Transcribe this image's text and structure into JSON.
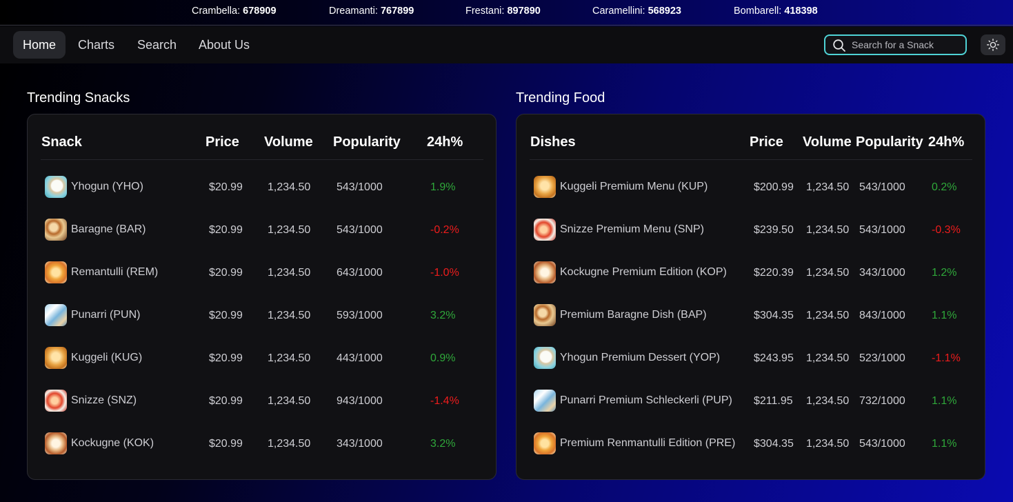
{
  "ticker": [
    {
      "name": "Crambella:",
      "value": "678909"
    },
    {
      "name": "Dreamanti:",
      "value": "767899"
    },
    {
      "name": "Frestani:",
      "value": "897890"
    },
    {
      "name": "Caramellini:",
      "value": "568923"
    },
    {
      "name": "Bombarell:",
      "value": "418398"
    }
  ],
  "nav": {
    "items": [
      "Home",
      "Charts",
      "Search",
      "About Us"
    ],
    "active": "Home"
  },
  "search": {
    "placeholder": "Search for a Snack",
    "value": ""
  },
  "colors": {
    "positive": "#2fa83a",
    "negative": "#ee1c1c",
    "search_border": "#4fd3d6"
  },
  "snacks": {
    "title": "Trending Snacks",
    "headers": [
      "Snack",
      "Price",
      "Volume",
      "Popularity",
      "24h%"
    ],
    "rows": [
      {
        "name": "Yhogun (YHO)",
        "price": "$20.99",
        "volume": "1,234.50",
        "popularity": "543/1000",
        "change": "1.9%",
        "trend": "up",
        "icon": "yhogun-thumb-icon"
      },
      {
        "name": "Baragne (BAR)",
        "price": "$20.99",
        "volume": "1,234.50",
        "popularity": "543/1000",
        "change": "-0.2%",
        "trend": "down",
        "icon": "baragne-thumb-icon"
      },
      {
        "name": "Remantulli (REM)",
        "price": "$20.99",
        "volume": "1,234.50",
        "popularity": "643/1000",
        "change": "-1.0%",
        "trend": "down",
        "icon": "remantulli-thumb-icon"
      },
      {
        "name": "Punarri (PUN)",
        "price": "$20.99",
        "volume": "1,234.50",
        "popularity": "593/1000",
        "change": "3.2%",
        "trend": "up",
        "icon": "punarri-thumb-icon"
      },
      {
        "name": "Kuggeli (KUG)",
        "price": "$20.99",
        "volume": "1,234.50",
        "popularity": "443/1000",
        "change": "0.9%",
        "trend": "up",
        "icon": "kuggeli-thumb-icon"
      },
      {
        "name": "Snizze (SNZ)",
        "price": "$20.99",
        "volume": "1,234.50",
        "popularity": "943/1000",
        "change": "-1.4%",
        "trend": "down",
        "icon": "snizze-thumb-icon"
      },
      {
        "name": "Kockugne (KOK)",
        "price": "$20.99",
        "volume": "1,234.50",
        "popularity": "343/1000",
        "change": "3.2%",
        "trend": "up",
        "icon": "kockugne-thumb-icon"
      }
    ]
  },
  "food": {
    "title": "Trending Food",
    "headers": [
      "Dishes",
      "Price",
      "Volume",
      "Popularity",
      "24h%"
    ],
    "rows": [
      {
        "name": "Kuggeli Premium Menu (KUP)",
        "price": "$200.99",
        "volume": "1,234.50",
        "popularity": "543/1000",
        "change": "0.2%",
        "trend": "up",
        "icon": "kuggeli-thumb-icon"
      },
      {
        "name": "Snizze Premium Menu (SNP)",
        "price": "$239.50",
        "volume": "1,234.50",
        "popularity": "543/1000",
        "change": "-0.3%",
        "trend": "down",
        "icon": "snizze-thumb-icon"
      },
      {
        "name": "Kockugne Premium Edition (KOP)",
        "price": "$220.39",
        "volume": "1,234.50",
        "popularity": "343/1000",
        "change": "1.2%",
        "trend": "up",
        "icon": "kockugne-thumb-icon"
      },
      {
        "name": "Premium Baragne Dish (BAP)",
        "price": "$304.35",
        "volume": "1,234.50",
        "popularity": "843/1000",
        "change": "1.1%",
        "trend": "up",
        "icon": "baragne-thumb-icon"
      },
      {
        "name": "Yhogun Premium Dessert (YOP)",
        "price": "$243.95",
        "volume": "1,234.50",
        "popularity": "523/1000",
        "change": "-1.1%",
        "trend": "down",
        "icon": "yhogun-thumb-icon"
      },
      {
        "name": "Punarri Premium Schleckerli (PUP)",
        "price": "$211.95",
        "volume": "1,234.50",
        "popularity": "732/1000",
        "change": "1.1%",
        "trend": "up",
        "icon": "punarri-thumb-icon"
      },
      {
        "name": "Premium Renmantulli Edition (PRE)",
        "price": "$304.35",
        "volume": "1,234.50",
        "popularity": "543/1000",
        "change": "1.1%",
        "trend": "up",
        "icon": "remantulli-thumb-icon"
      }
    ]
  }
}
